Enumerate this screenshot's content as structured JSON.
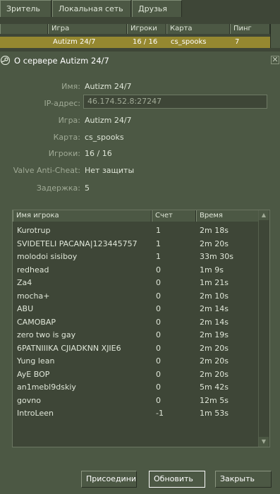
{
  "tabs": [
    "Зритель",
    "Локальная сеть",
    "Друзья"
  ],
  "server_list": {
    "headers": [
      "Игра",
      "Игроки",
      "Карта",
      "Пинг"
    ],
    "row": {
      "name": "Autizm 24/7",
      "players": "16 / 16",
      "map": "cs_spooks",
      "ping": "7"
    }
  },
  "info": {
    "title": "О сервере Autizm 24/7",
    "fields": [
      {
        "label": "Имя:",
        "value": "Autizm 24/7"
      },
      {
        "label": "IP-адрес:",
        "value": "46.174.52.8:27247"
      },
      {
        "label": "Игра:",
        "value": "Autizm 24/7"
      },
      {
        "label": "Карта:",
        "value": "cs_spooks"
      },
      {
        "label": "Игроки:",
        "value": "16 / 16"
      },
      {
        "label": "Valve Anti-Cheat:",
        "value": "Нет защиты"
      },
      {
        "label": "Задержка:",
        "value": "5"
      }
    ]
  },
  "player_list": {
    "headers": [
      "Имя игрока",
      "Счет",
      "Время"
    ],
    "rows": [
      [
        "Kurotrup",
        "1",
        "2m 18s"
      ],
      [
        "SVIDETELI PACANA|123445757",
        "1",
        "2m 20s"
      ],
      [
        "molodoi sisiboy",
        "1",
        "33m 30s"
      ],
      [
        "redhead",
        "0",
        "1m 9s"
      ],
      [
        "Za4",
        "0",
        "1m 21s"
      ],
      [
        "mocha+",
        "0",
        "2m 10s"
      ],
      [
        "ABU",
        "0",
        "2m 14s"
      ],
      [
        "CAMOBAP",
        "0",
        "2m 14s"
      ],
      [
        "zero two is gay",
        "0",
        "2m 19s"
      ],
      [
        "6PATNIIIKA CJIADKNN XJIE6",
        "0",
        "2m 20s"
      ],
      [
        "Yung lean",
        "0",
        "2m 20s"
      ],
      [
        "AyE BOP",
        "0",
        "2m 20s"
      ],
      [
        "an1mebl9dskiy",
        "0",
        "5m 42s"
      ],
      [
        "govno",
        "0",
        "12m 5s"
      ],
      [
        "IntroLeen",
        "-1",
        "1m 53s"
      ]
    ]
  },
  "buttons": {
    "join": "Присоединиться",
    "refresh": "Обновить",
    "close": "Закрыть"
  },
  "icons": {
    "steam": "steam-icon",
    "close": "close-icon",
    "scroll_up": "scroll-up-icon",
    "scroll_down": "scroll-down-icon"
  },
  "colors": {
    "background": "#4c5844",
    "selected_row": "#958830"
  }
}
